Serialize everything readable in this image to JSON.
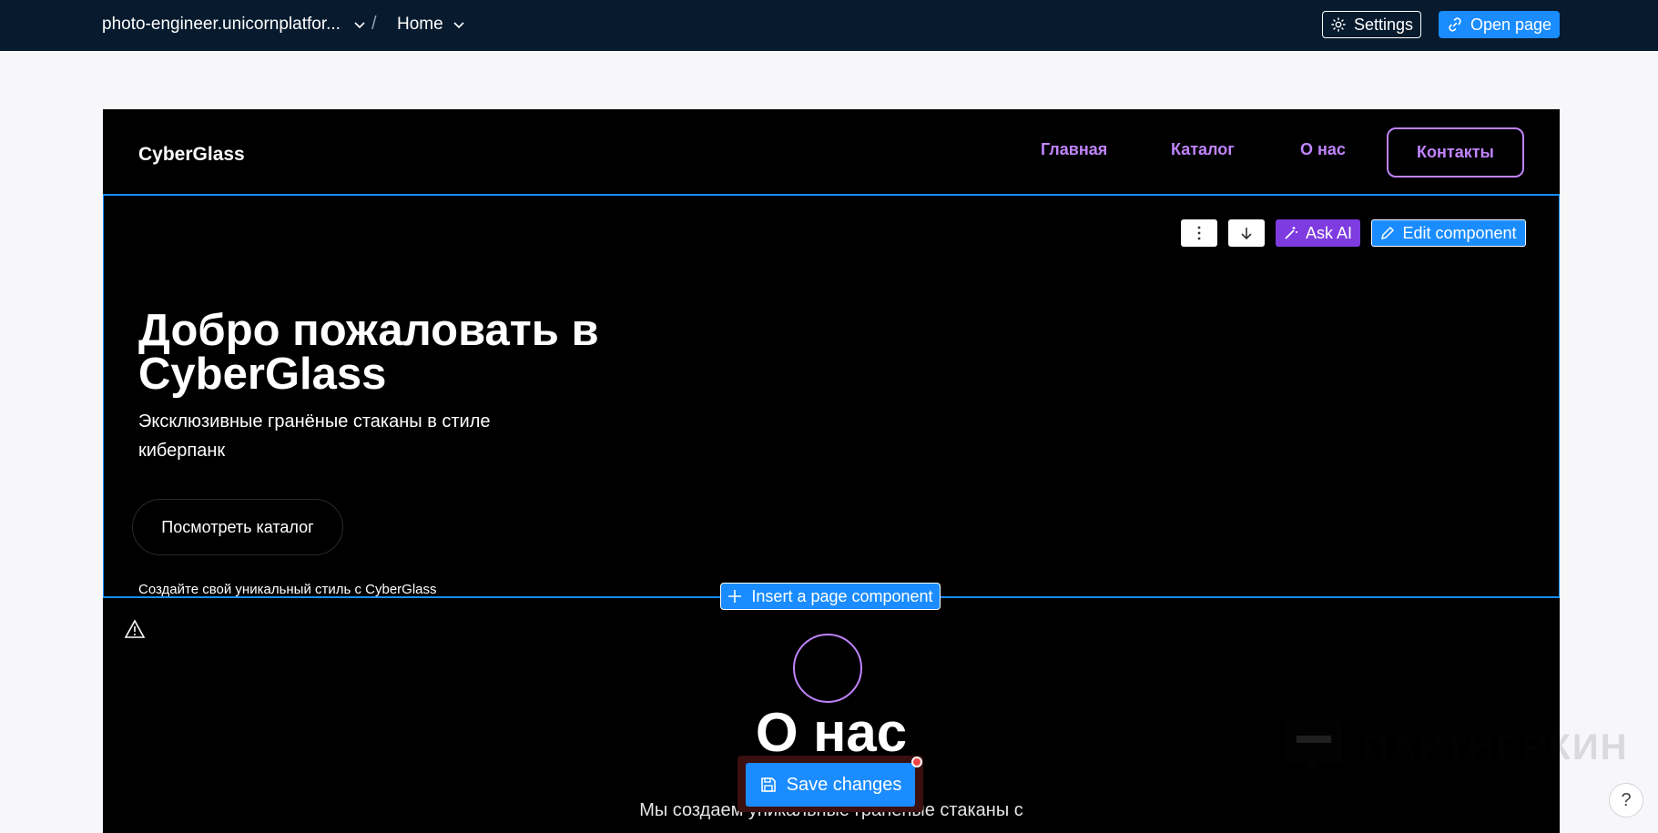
{
  "topbar": {
    "site_name": "photo-engineer.unicornplatfor...",
    "separator": "/",
    "page_name": "Home",
    "settings_label": "Settings",
    "open_page_label": "Open page"
  },
  "site": {
    "brand": "CyberGlass",
    "nav": [
      "Главная",
      "Каталог",
      "О нас",
      "Контакты"
    ]
  },
  "hero": {
    "title": "Добро пожаловать в CyberGlass",
    "subtitle": "Эксклюзивные гранёные стаканы в стиле киберпанк",
    "cta": "Посмотреть каталог",
    "note": "Создайте свой уникальный стиль с CyberGlass"
  },
  "component_tools": {
    "ask_ai_label": "Ask AI",
    "edit_label": "Edit component",
    "insert_label": "Insert a page component"
  },
  "about": {
    "title": "О нас",
    "text": "Мы создаем уникальные гранёные стаканы с"
  },
  "watermark": "ПАРТНЕРКИН",
  "save_label": "Save changes",
  "help_label": "?",
  "colors": {
    "topbar": "#071a2e",
    "accent": "#1a8cff",
    "purple": "#c084fc",
    "ai": "#7e3be0"
  }
}
